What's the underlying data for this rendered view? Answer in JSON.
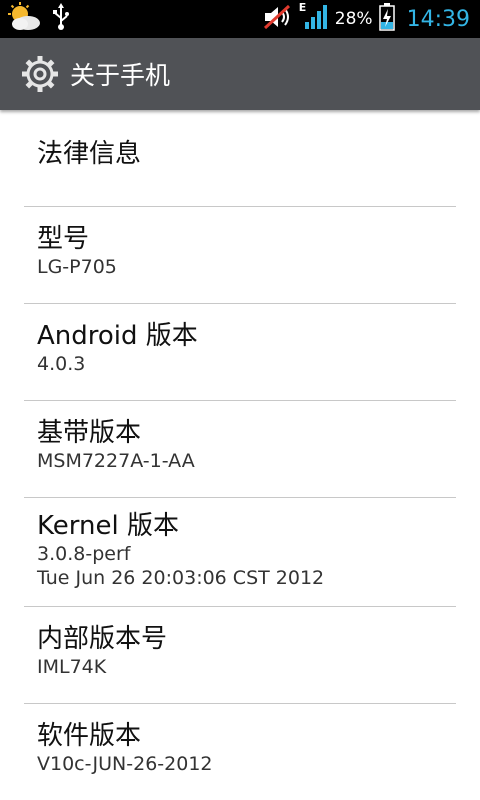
{
  "status_bar": {
    "battery_percent": "28%",
    "clock": "14:39",
    "network_type": "E",
    "icons": [
      "weather-icon",
      "usb-icon",
      "volume-muted-icon",
      "signal-icon",
      "battery-charging-icon"
    ]
  },
  "action_bar": {
    "title": "关于手机",
    "icon": "settings-gear-icon"
  },
  "items": [
    {
      "title": "法律信息"
    },
    {
      "title": "型号",
      "summary": "LG-P705"
    },
    {
      "title": "Android 版本",
      "summary": "4.0.3"
    },
    {
      "title": "基带版本",
      "summary": "MSM7227A-1-AA"
    },
    {
      "title": "Kernel 版本",
      "summary": "3.0.8-perf",
      "summary2": "Tue Jun 26 20:03:06 CST 2012"
    },
    {
      "title": "内部版本号",
      "summary": "IML74K"
    },
    {
      "title": "软件版本",
      "summary": "V10c-JUN-26-2012"
    }
  ],
  "colors": {
    "status_bar_bg": "#000000",
    "action_bar_bg": "#505256",
    "clock": "#33b5e5",
    "divider": "#c8c8c8"
  }
}
